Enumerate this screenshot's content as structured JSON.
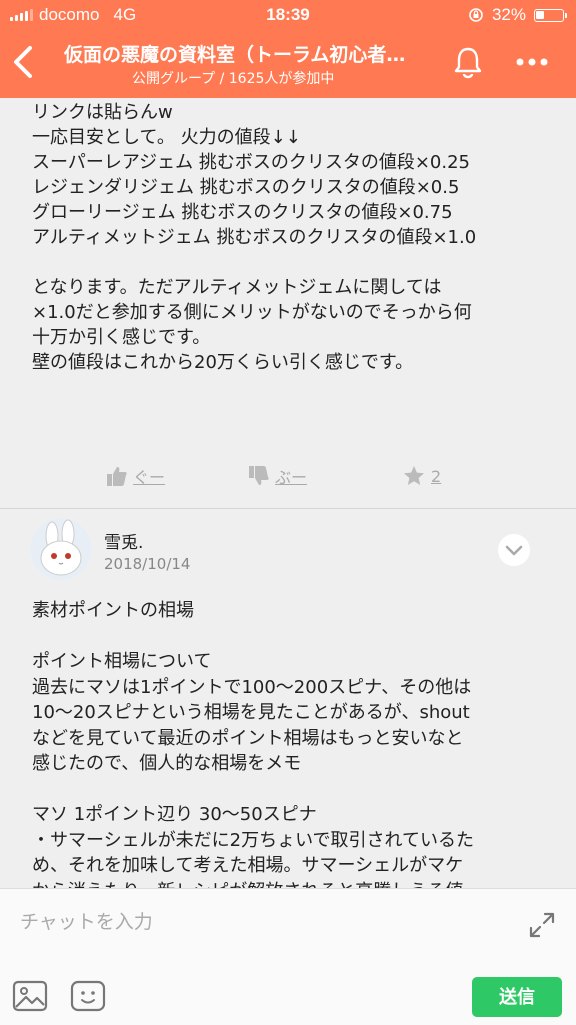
{
  "status_bar": {
    "carrier": "docomo",
    "network": "4G",
    "time": "18:39",
    "battery": "32%",
    "battery_level": 0.32
  },
  "header": {
    "title": "仮面の悪魔の資料室（トーラム初心者…",
    "subtitle": "公開グループ / 1625人が参加中",
    "icons": [
      "back-icon",
      "bell-icon",
      "more-icon"
    ]
  },
  "post1": {
    "text": "リンクは貼らんw\n一応目安として。 火力の値段↓↓\nスーパーレアジェム 挑むボスのクリスタの値段×0.25\nレジェンダリジェム 挑むボスのクリスタの値段×0.5\nグローリージェム 挑むボスのクリスタの値段×0.75\nアルティメットジェム 挑むボスのクリスタの値段×1.0\n\nとなります。ただアルティメットジェムに関しては\n×1.0だと参加する側にメリットがないのでそっから何\n十万か引く感じです。\n壁の値段はこれから20万くらい引く感じです。",
    "actions": {
      "like": "ぐー",
      "dislike": "ぶー",
      "star_count": "2"
    }
  },
  "post2": {
    "author": "雪兎.",
    "date": "2018/10/14",
    "text": "素材ポイントの相場\n\nポイント相場について\n過去にマソは1ポイントで100〜200スピナ、その他は\n10〜20スピナという相場を見たことがあるが、shout\nなどを見ていて最近のポイント相場はもっと安いなと\n感じたので、個人的な相場をメモ\n\nマソ 1ポイント辺り 30〜50スピナ\n・サマーシェルが未だに2万ちょいで取引されているた\nめ、それを加味して考えた相場。サマーシェルがマケ\nから消えたり、新レシピが解放されると高騰しうる値"
  },
  "input_bar": {
    "placeholder": "チャットを入力",
    "send_label": "送信"
  },
  "colors": {
    "header": "#ff7a52",
    "send": "#2ec866",
    "background": "#efefef"
  }
}
